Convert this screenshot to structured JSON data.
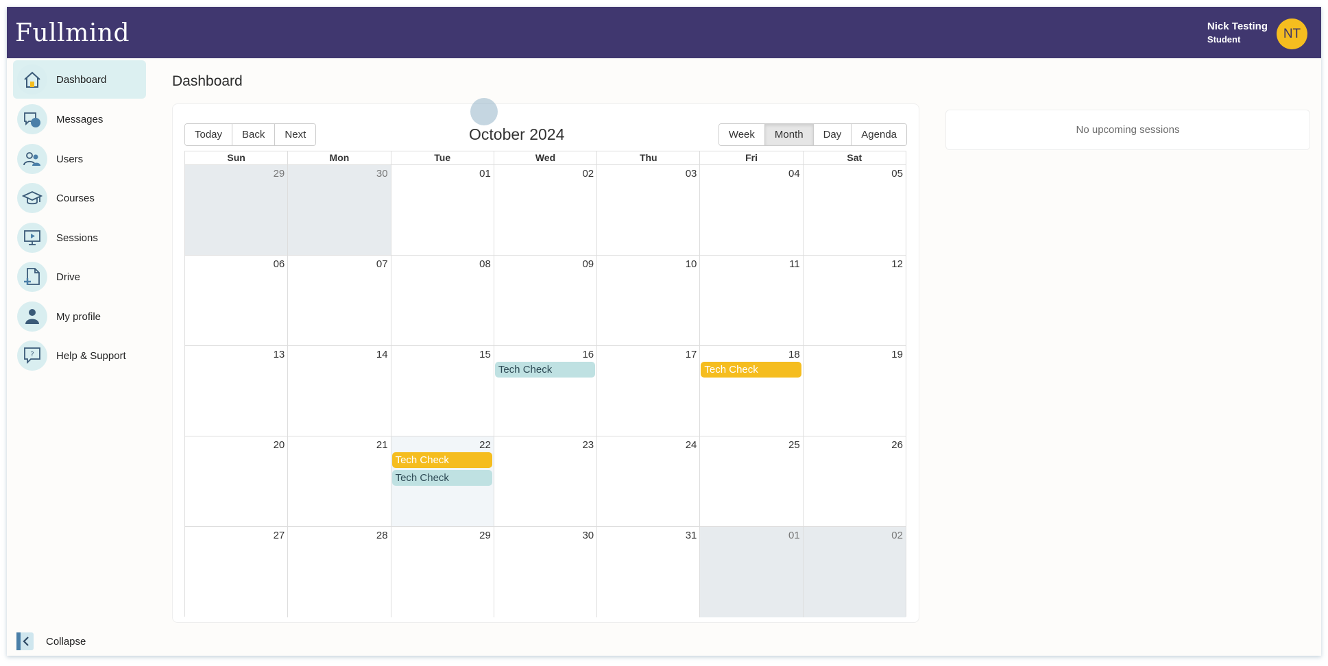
{
  "app": {
    "logo": "Fullmind",
    "user_name": "Nick Testing",
    "user_role": "Student",
    "avatar_initials": "NT",
    "colors": {
      "topbar": "#40376f",
      "accent": "#f5bd1f",
      "teal": "#bfe1e2"
    }
  },
  "sidebar": {
    "items": [
      {
        "label": "Dashboard",
        "icon": "house-icon",
        "active": true
      },
      {
        "label": "Messages",
        "icon": "chat-bubbles-icon"
      },
      {
        "label": "Users",
        "icon": "users-icon"
      },
      {
        "label": "Courses",
        "icon": "graduation-cap-icon"
      },
      {
        "label": "Sessions",
        "icon": "monitor-play-icon"
      },
      {
        "label": "Drive",
        "icon": "file-add-icon"
      },
      {
        "label": "My profile",
        "icon": "person-icon"
      },
      {
        "label": "Help & Support",
        "icon": "help-chat-icon"
      }
    ],
    "collapse_label": "Collapse"
  },
  "main": {
    "page_title": "Dashboard",
    "calendar": {
      "nav_buttons": [
        "Today",
        "Back",
        "Next"
      ],
      "title": "October 2024",
      "views": [
        "Week",
        "Month",
        "Day",
        "Agenda"
      ],
      "active_view": "Month",
      "weekdays": [
        "Sun",
        "Mon",
        "Tue",
        "Wed",
        "Thu",
        "Fri",
        "Sat"
      ],
      "weeks": [
        [
          "29",
          "30",
          "01",
          "02",
          "03",
          "04",
          "05"
        ],
        [
          "06",
          "07",
          "08",
          "09",
          "10",
          "11",
          "12"
        ],
        [
          "13",
          "14",
          "15",
          "16",
          "17",
          "18",
          "19"
        ],
        [
          "20",
          "21",
          "22",
          "23",
          "24",
          "25",
          "26"
        ],
        [
          "27",
          "28",
          "29",
          "30",
          "31",
          "01",
          "02"
        ]
      ],
      "events": [
        {
          "title": "Tech Check",
          "date": "16",
          "color": "teal"
        },
        {
          "title": "Tech Check",
          "date": "18",
          "color": "gold"
        },
        {
          "title": "Tech Check",
          "date": "22",
          "color": "gold"
        },
        {
          "title": "Tech Check",
          "date": "22",
          "color": "teal"
        }
      ]
    },
    "upcoming_sessions": "No upcoming sessions"
  }
}
